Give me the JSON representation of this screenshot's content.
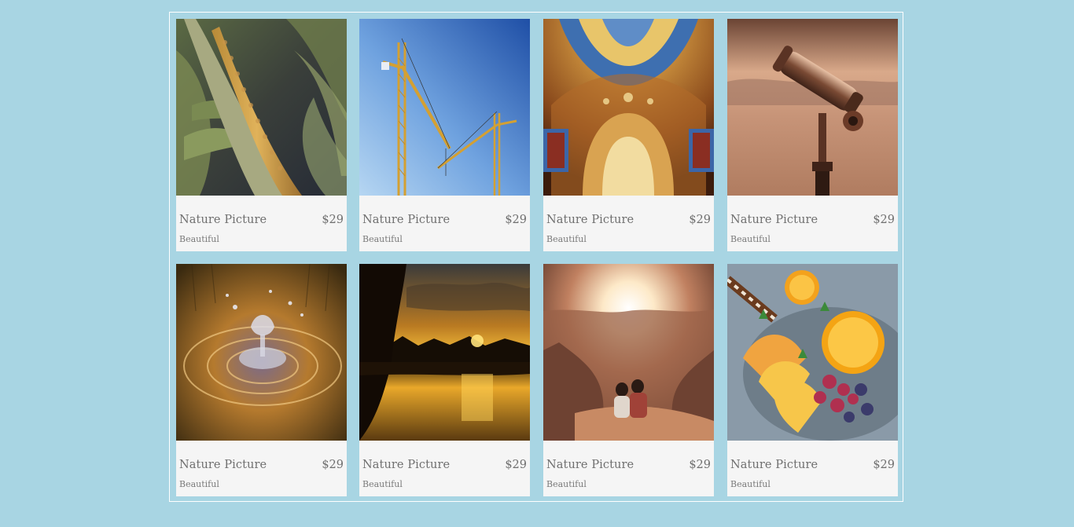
{
  "products": [
    {
      "title": "Nature Picture",
      "price": "$29",
      "subtitle": "Beautiful",
      "image": "corn-photo"
    },
    {
      "title": "Nature Picture",
      "price": "$29",
      "subtitle": "Beautiful",
      "image": "cranes-photo"
    },
    {
      "title": "Nature Picture",
      "price": "$29",
      "subtitle": "Beautiful",
      "image": "cathedral-ceiling-photo"
    },
    {
      "title": "Nature Picture",
      "price": "$29",
      "subtitle": "Beautiful",
      "image": "telescope-photo"
    },
    {
      "title": "Nature Picture",
      "price": "$29",
      "subtitle": "Beautiful",
      "image": "water-drop-photo"
    },
    {
      "title": "Nature Picture",
      "price": "$29",
      "subtitle": "Beautiful",
      "image": "lake-sunset-photo"
    },
    {
      "title": "Nature Picture",
      "price": "$29",
      "subtitle": "Beautiful",
      "image": "canyon-couple-photo"
    },
    {
      "title": "Nature Picture",
      "price": "$29",
      "subtitle": "Beautiful",
      "image": "fruit-plate-photo"
    }
  ],
  "colors": {
    "page_background": "#a8d5e3",
    "card_background": "#f5f5f5",
    "gallery_border": "#ffffff",
    "text": "#6f6f6f"
  }
}
